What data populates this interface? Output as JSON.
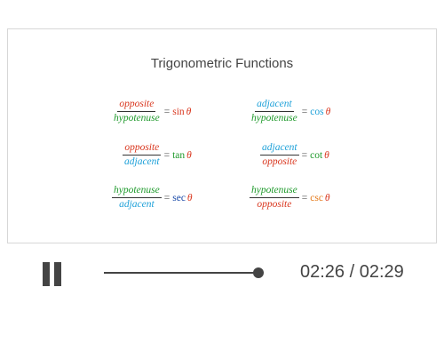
{
  "colors": {
    "red": "#d9371f",
    "blue": "#1a9fd8",
    "green": "#1f9a2c",
    "navy": "#1a4aa8",
    "orange": "#e57a1a",
    "dark": "#444444"
  },
  "slide": {
    "title": "Trigonometric Functions",
    "formulas": [
      {
        "num": "opposite",
        "num_color": "red",
        "den": "hypotenuse",
        "den_color": "green",
        "eq": "=",
        "fn": "sin",
        "fn_color": "red",
        "theta": "θ"
      },
      {
        "num": "adjacent",
        "num_color": "blue",
        "den": "hypotenuse",
        "den_color": "green",
        "eq": "=",
        "fn": "cos",
        "fn_color": "blue",
        "theta": "θ"
      },
      {
        "num": "opposite",
        "num_color": "red",
        "den": "adjacent",
        "den_color": "blue",
        "eq": "=",
        "fn": "tan",
        "fn_color": "green",
        "theta": "θ"
      },
      {
        "num": "adjacent",
        "num_color": "blue",
        "den": "opposite",
        "den_color": "red",
        "eq": "=",
        "fn": "cot",
        "fn_color": "green",
        "theta": "θ"
      },
      {
        "num": "hypotenuse",
        "num_color": "green",
        "den": "adjacent",
        "den_color": "blue",
        "eq": "=",
        "fn": "sec",
        "fn_color": "navy",
        "theta": "θ"
      },
      {
        "num": "hypotenuse",
        "num_color": "green",
        "den": "opposite",
        "den_color": "red",
        "eq": "=",
        "fn": "csc",
        "fn_color": "orange",
        "theta": "θ"
      }
    ]
  },
  "player": {
    "pause_icon": "pause-icon",
    "progress": 0.98,
    "time_display": "02:26 / 02:29"
  }
}
